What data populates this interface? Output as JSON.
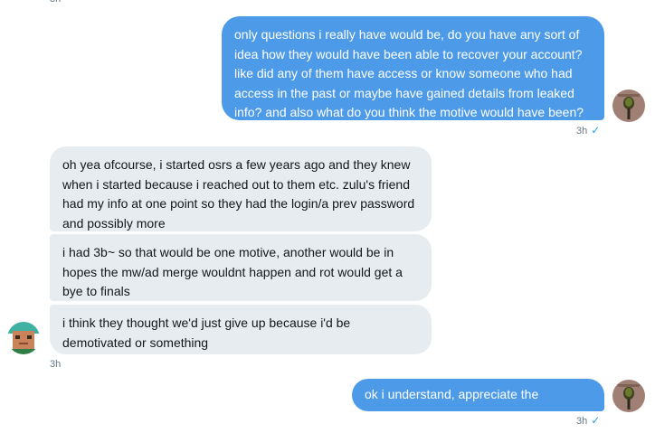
{
  "conversation": {
    "top_timestamp": "3h",
    "messages": [
      {
        "direction": "outgoing",
        "text": "only questions i really have would be, do you have any sort of idea how they would have been able to recover your account? like did any of them have access or know someone who had access in the past or maybe have gained details from leaked info? and also what do you think the motive would have been?",
        "timestamp": "3h",
        "read": "✓"
      },
      {
        "direction": "incoming",
        "text": "oh yea ofcourse, i started osrs a few years ago and they knew when i started because i reached out to them etc. zulu's friend had my info at one point so they had the login/a prev password and possibly more"
      },
      {
        "direction": "incoming",
        "text": "i had 3b~ so that would be one motive, another would be in hopes the mw/ad merge wouldnt happen and rot would get a bye to finals"
      },
      {
        "direction": "incoming",
        "text": "i think they thought we'd just give up because i'd be demotivated or something",
        "timestamp": "3h"
      },
      {
        "direction": "outgoing",
        "text": "ok i understand, appreciate the response",
        "timestamp": "3h",
        "read": "✓"
      }
    ]
  },
  "avatars": {
    "self": {
      "icon": "microphone-avatar-icon",
      "bg": "#a07f74"
    },
    "other": {
      "icon": "pixel-character-avatar-icon",
      "bg": "#3fb1a2"
    }
  },
  "colors": {
    "outgoing_bubble": "#4d9be8",
    "incoming_bubble": "#e6ecf0",
    "timestamp": "#657786",
    "read_check": "#1da1f2"
  }
}
